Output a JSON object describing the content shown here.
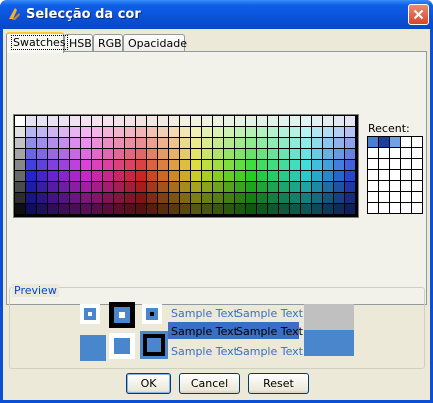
{
  "window": {
    "title": "Selecção da cor",
    "close_label": "Close"
  },
  "tabs": [
    {
      "label": "Swatches",
      "active": true
    },
    {
      "label": "HSB",
      "active": false
    },
    {
      "label": "RGB",
      "active": false
    },
    {
      "label": "Opacidade",
      "active": false
    }
  ],
  "swatches": {
    "recent_label": "Recent:",
    "recent_colors": [
      "#4a7fd0",
      "#1c3f9e",
      "#6fa2e0"
    ]
  },
  "preview": {
    "label": "Preview",
    "sample_text": "Sample Text",
    "selected_color": "#4a86cb",
    "highlight_color": "#3a6fc5"
  },
  "buttons": {
    "ok": "OK",
    "cancel": "Cancel",
    "reset": "Reset"
  },
  "colors": {
    "titlebar": "#0a52d8",
    "dialog_bg": "#ece9d8"
  }
}
